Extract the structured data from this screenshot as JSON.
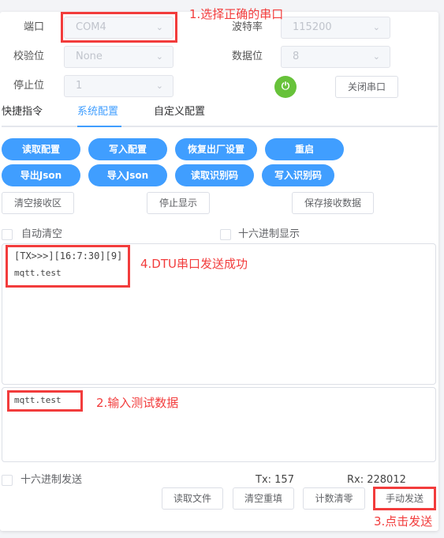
{
  "serial": {
    "port": {
      "label": "端口",
      "value": "COM4"
    },
    "baud": {
      "label": "波特率",
      "value": "115200"
    },
    "parity": {
      "label": "校验位",
      "value": "None"
    },
    "databits": {
      "label": "数据位",
      "value": "8"
    },
    "stopbits": {
      "label": "停止位",
      "value": "1"
    },
    "power_color": "#67c23a",
    "close_label": "关闭串口"
  },
  "tabs": [
    {
      "label": "快捷指令",
      "active": false
    },
    {
      "label": "系统配置",
      "active": true
    },
    {
      "label": "自定义配置",
      "active": false
    }
  ],
  "actions": [
    "读取配置",
    "写入配置",
    "恢复出厂设置",
    "重启",
    "导出Json",
    "导入Json",
    "读取识别码",
    "写入识别码"
  ],
  "receive_buttons": [
    "清空接收区",
    "停止显示",
    "保存接收数据"
  ],
  "options": {
    "auto_clear": "自动清空",
    "hex_display": "十六进制显示",
    "hex_send": "十六进制发送"
  },
  "receive": {
    "line1": "[TX>>>][16:7:30][9]",
    "line2": "mqtt.test"
  },
  "send": {
    "value": "mqtt.test"
  },
  "counters": {
    "tx": "Tx: 157",
    "rx": "Rx: 228012"
  },
  "send_buttons": [
    "读取文件",
    "清空重填",
    "计数清零",
    "手动发送"
  ],
  "annotations": {
    "a1": "1.选择正确的串口",
    "a2": "2.输入测试数据",
    "a3": "3.点击发送",
    "a4": "4.DTU串口发送成功"
  },
  "colors": {
    "accent": "#409eff",
    "annotation": "#f23c3c"
  }
}
